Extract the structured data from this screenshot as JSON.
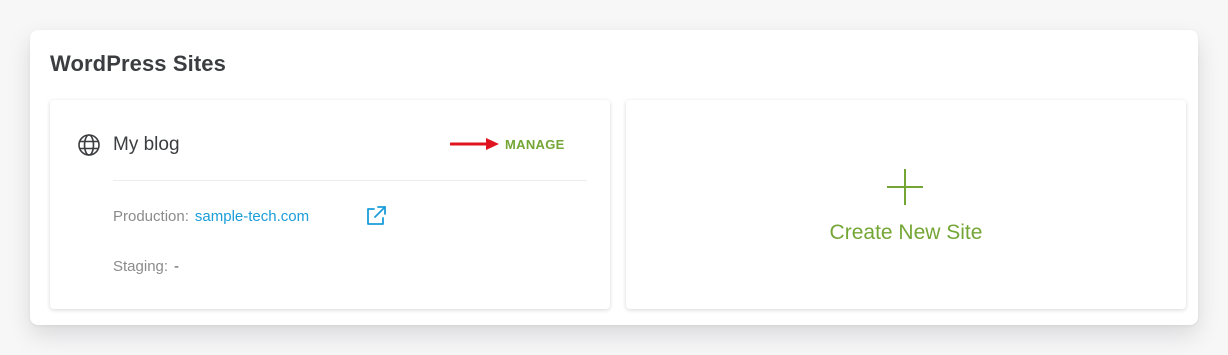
{
  "section": {
    "title": "WordPress Sites"
  },
  "site_card": {
    "name": "My blog",
    "icon": "globe-icon",
    "manage_label": "MANAGE",
    "production_label": "Production:",
    "production_url": "sample-tech.com",
    "staging_label": "Staging:",
    "staging_value": "-"
  },
  "create_card": {
    "icon": "plus-icon",
    "label": "Create New Site"
  },
  "colors": {
    "accent_green": "#74a636",
    "link_blue": "#1a9dd9",
    "annotation_red": "#e0141e"
  }
}
